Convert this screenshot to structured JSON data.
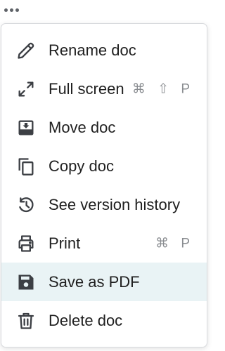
{
  "topbar": {
    "more_icon": "more-horizontal-icon"
  },
  "menu": {
    "items": [
      {
        "label": "Rename doc",
        "icon": "pencil-icon",
        "shortcut": ""
      },
      {
        "label": "Full screen",
        "icon": "expand-arrows-icon",
        "shortcut": "⌘ ⇧ P"
      },
      {
        "label": "Move doc",
        "icon": "move-inbox-icon",
        "shortcut": ""
      },
      {
        "label": "Copy doc",
        "icon": "copy-icon",
        "shortcut": ""
      },
      {
        "label": "See version history",
        "icon": "history-icon",
        "shortcut": ""
      },
      {
        "label": "Print",
        "icon": "printer-icon",
        "shortcut": "⌘ P"
      },
      {
        "label": "Save as PDF",
        "icon": "save-floppy-icon",
        "shortcut": ""
      },
      {
        "label": "Delete doc",
        "icon": "trash-icon",
        "shortcut": ""
      }
    ],
    "highlighted_item": "Save as PDF"
  },
  "colors": {
    "icon": "#3c3f44",
    "text": "#1f1f1f",
    "shortcut": "#8a8d91",
    "highlight_bg": "#e9f3f5",
    "border": "#d8dadd"
  }
}
